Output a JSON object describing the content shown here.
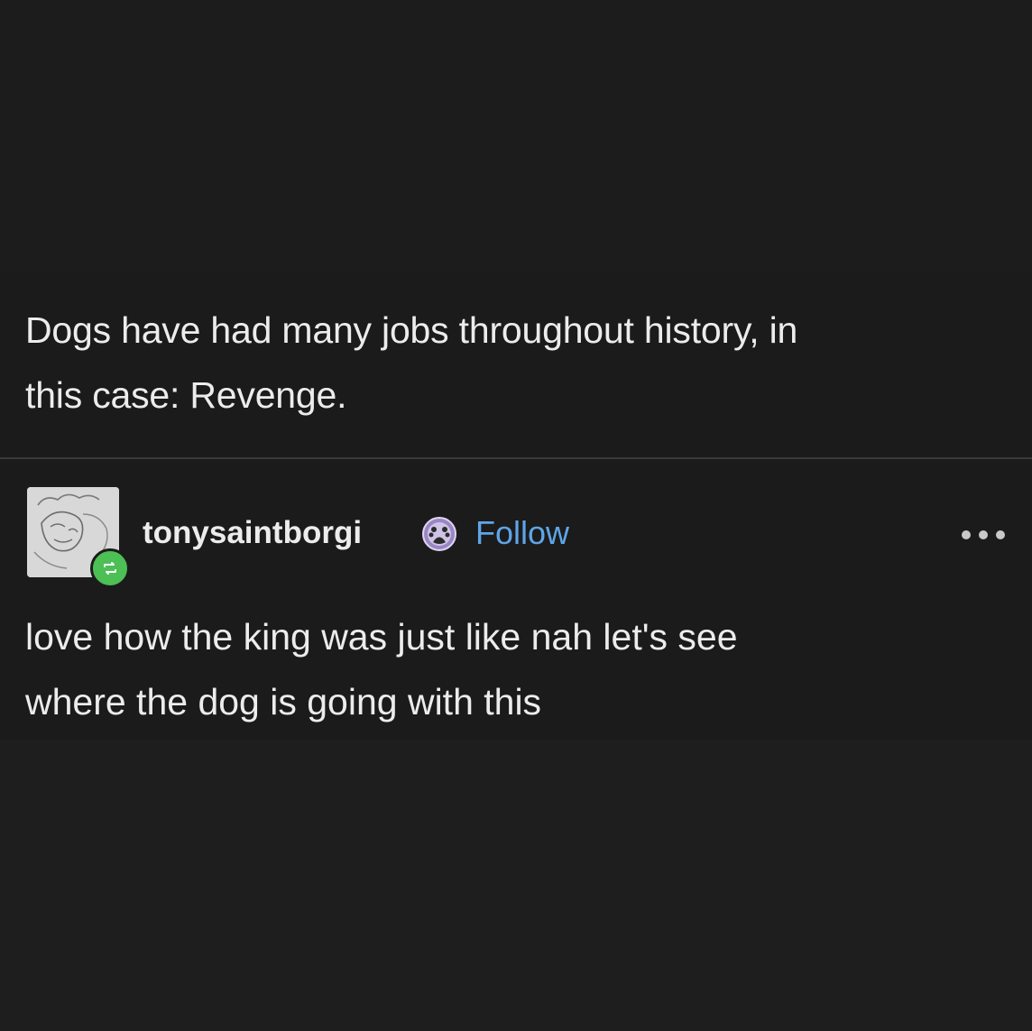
{
  "post": {
    "text_line1": "Dogs have had many jobs throughout history, in",
    "text_line2": "this case: Revenge."
  },
  "reply": {
    "avatar_icon": "sketch-avatar-icon",
    "reblog_icon": "reblog-icon",
    "reblog_color": "#4cbf55",
    "username": "tonysaintborgi",
    "badge_icon": "paw-badge-icon",
    "follow_label": "Follow",
    "follow_color": "#5fa5e8",
    "more_icon": "more-options-icon",
    "text_line1": "love how the king was just like nah let's see",
    "text_line2": "where the dog is going with this"
  }
}
